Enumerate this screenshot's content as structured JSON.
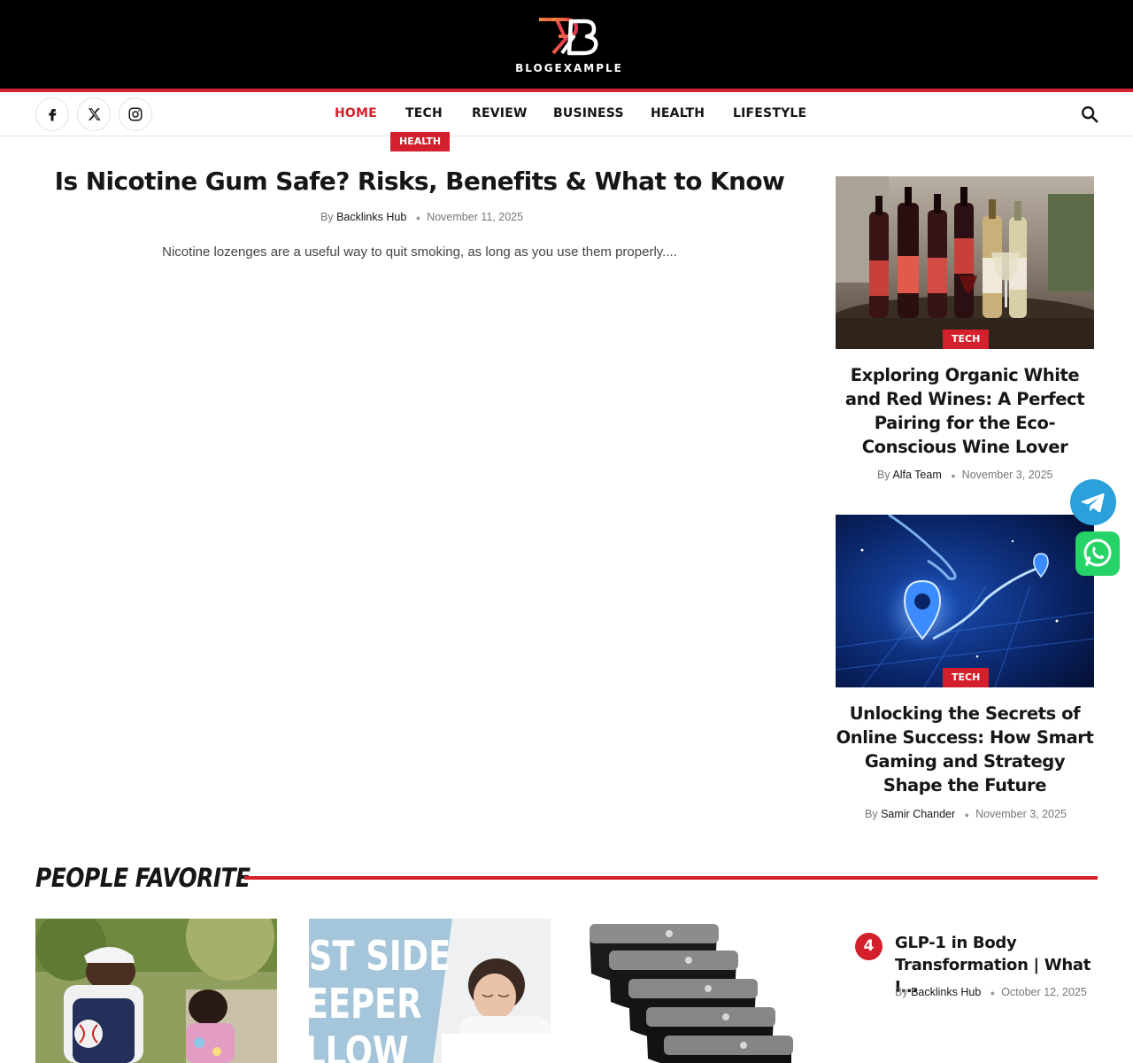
{
  "brand": {
    "name": "BLOGEXAMPLE",
    "accent": "#d4202c",
    "header_bg": "#000000"
  },
  "social": [
    {
      "name": "facebook-icon"
    },
    {
      "name": "x-icon"
    },
    {
      "name": "instagram-icon"
    }
  ],
  "nav": {
    "items": [
      "HOME",
      "TECH",
      "REVIEW",
      "BUSINESS",
      "HEALTH",
      "LIFESTYLE"
    ],
    "active": "HOME",
    "search_icon": "search-icon"
  },
  "main_post": {
    "category": "HEALTH",
    "title": "Is Nicotine Gum Safe? Risks, Benefits & What to Know",
    "by": "By",
    "author": "Backlinks Hub",
    "date": "November 11, 2025",
    "excerpt": "Nicotine lozenges are a useful way to quit  smoking, as long as you use them properly...."
  },
  "side_posts": [
    {
      "category": "TECH",
      "title": "Exploring Organic White and Red Wines: A Perfect Pairing for the Eco-Conscious Wine Lover",
      "by": "By",
      "author": "Alfa Team",
      "date": "November 3, 2025"
    },
    {
      "category": "TECH",
      "title": "Unlocking the Secrets of Online Success: How Smart Gaming and Strategy Shape the Future",
      "by": "By",
      "author": "Samir Chander",
      "date": "November 3, 2025"
    }
  ],
  "floating": [
    {
      "name": "telegram-icon",
      "color": "#2aa1da"
    },
    {
      "name": "whatsapp-icon",
      "color": "#25d366"
    }
  ],
  "people_favorite": {
    "heading": "PEOPLE FAVORITE",
    "pillow_text": [
      "ST SIDE",
      "EEPER",
      "LLOW"
    ],
    "list": [
      {
        "rank": "4",
        "title": "GLP-1 in Body Transformation | What I...",
        "by": "By",
        "author": "Backlinks Hub",
        "date": "October 12, 2025"
      }
    ]
  }
}
